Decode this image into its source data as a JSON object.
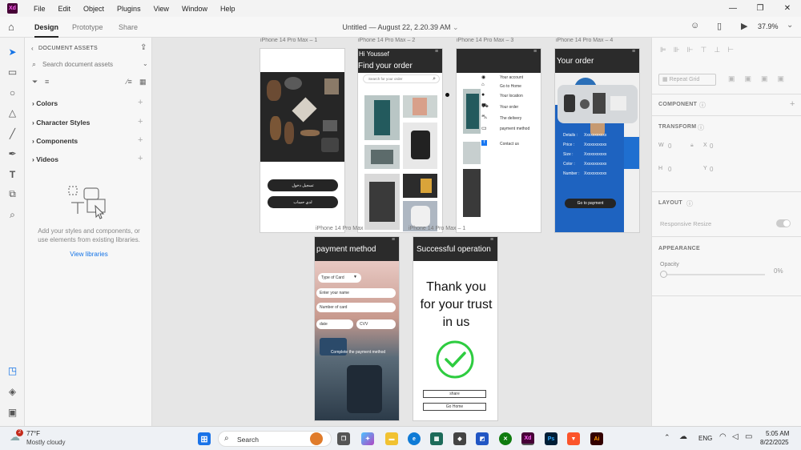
{
  "menubar": {
    "app_icon": "Xd",
    "items": [
      "File",
      "Edit",
      "Object",
      "Plugins",
      "View",
      "Window",
      "Help"
    ]
  },
  "topbar": {
    "tabs": [
      "Design",
      "Prototype",
      "Share"
    ],
    "document_title": "Untitled — August 22, 2.20.39 AM",
    "zoom": "37.9%"
  },
  "assets": {
    "header": "DOCUMENT ASSETS",
    "search_placeholder": "Search document assets",
    "sections": [
      "Colors",
      "Character Styles",
      "Components",
      "Videos"
    ],
    "empty_message": "Add your styles and components, or use elements from existing libraries.",
    "view_libraries": "View libraries"
  },
  "artboards": {
    "a1": {
      "label": "iPhone 14 Pro Max – 1",
      "button1": "تسجيل دخول",
      "button2": "لدي حساب"
    },
    "a2": {
      "label": "iPhone 14 Pro Max – 2",
      "greeting": "Hi Youssef",
      "title": "Find your order",
      "search_placeholder": "Search for your order"
    },
    "a3": {
      "label": "iPhone 14 Pro Max – 3",
      "menu": [
        "Your account",
        "Go to Home",
        "Your location",
        "Your order",
        "The delivery",
        "payment method",
        "Contact us"
      ]
    },
    "a4": {
      "label": "iPhone 14 Pro Max – 4",
      "title": "Your order",
      "details_labels": [
        "Details :",
        "Price :",
        "Size :",
        "Color :",
        "Number :"
      ],
      "details_value": "Xxxxxxxxxxx",
      "button": "Go to payment"
    },
    "a5": {
      "label": "iPhone 14 Pro Max",
      "title": "payment method",
      "card_type": "Type of Card",
      "name_placeholder": "Enter your name",
      "number_placeholder": "Number of card",
      "date_placeholder": "date",
      "cvv_placeholder": "CVV",
      "button": "Complete the payment method"
    },
    "a6": {
      "label": "iPhone 14 Pro Max – 1",
      "title": "Successful operation",
      "message": "Thank you for your trust in us",
      "share_button": "share",
      "home_button": "Go Home"
    }
  },
  "properties": {
    "repeat_grid": "Repeat Grid",
    "component": "COMPONENT",
    "transform": "TRANSFORM",
    "w_label": "W",
    "w_value": "0",
    "x_label": "X",
    "x_value": "0",
    "h_label": "H",
    "h_value": "0",
    "y_label": "Y",
    "y_value": "0",
    "layout": "LAYOUT",
    "responsive_resize": "Responsive Resize",
    "appearance": "APPEARANCE",
    "opacity_label": "Opacity",
    "opacity_value": "0%"
  },
  "taskbar": {
    "weather_temp": "77°F",
    "weather_desc": "Mostly cloudy",
    "weather_badge": "2",
    "search": "Search",
    "lang": "ENG",
    "time": "5:05 AM",
    "date": "8/22/2025"
  },
  "colors": {
    "xd_purple": "#470137",
    "xd_pink": "#ff61f6",
    "accent_blue": "#1473e6",
    "success_green": "#2ecc40",
    "dark": "#252525"
  }
}
